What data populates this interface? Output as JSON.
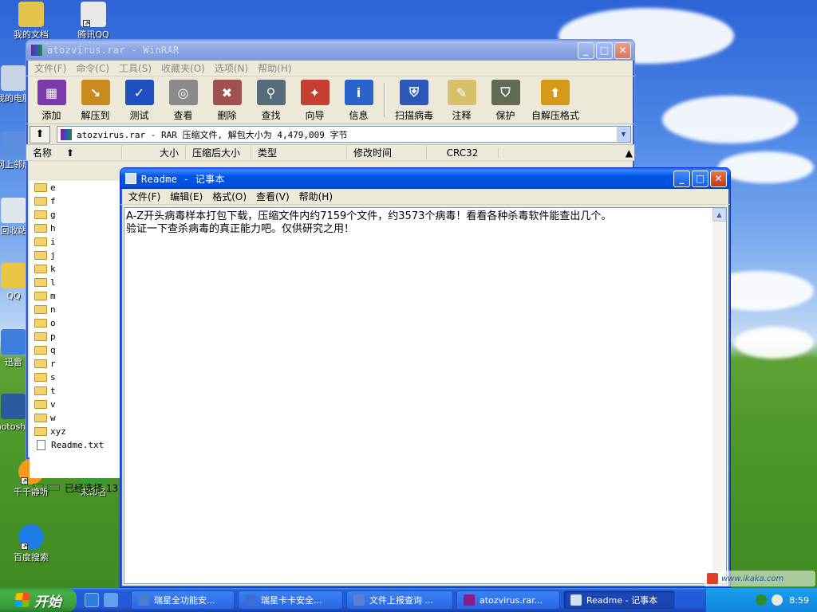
{
  "desktop": {
    "icons": [
      {
        "label": "我的文档",
        "color": "#e3c34a"
      },
      {
        "label": "腾讯QQ",
        "color": "#e8e8e8"
      },
      {
        "label": "我的电脑",
        "color": "#c8d3e6"
      },
      {
        "label": "网上邻居",
        "color": "#5b8ede"
      },
      {
        "label": "回收站",
        "color": "#dfe6ee"
      },
      {
        "label": "QQ",
        "color": "#e9c542"
      },
      {
        "label": "迅雷",
        "color": "#3d7fde"
      },
      {
        "label": "Photoshop",
        "color": "#2c5aa0"
      },
      {
        "label": "千千静听",
        "color": "#f39a1c"
      },
      {
        "label": "未命名",
        "color": "#3a9a3a"
      },
      {
        "label": "百度搜索",
        "color": "#1f7de6"
      }
    ]
  },
  "winrar": {
    "title": "atozvirus.rar - WinRAR",
    "menu": [
      "文件(F)",
      "命令(C)",
      "工具(S)",
      "收藏夹(O)",
      "选项(N)",
      "帮助(H)"
    ],
    "toolbar": [
      {
        "label": "添加",
        "icon": "add-archive-icon",
        "color": "#7a3aa8"
      },
      {
        "label": "解压到",
        "icon": "extract-to-icon",
        "color": "#c98a1e"
      },
      {
        "label": "测试",
        "icon": "test-icon",
        "color": "#1d4fbf"
      },
      {
        "label": "查看",
        "icon": "view-icon",
        "color": "#8a8a8a"
      },
      {
        "label": "删除",
        "icon": "delete-icon",
        "color": "#a05050"
      },
      {
        "label": "查找",
        "icon": "find-icon",
        "color": "#556b7a"
      },
      {
        "label": "向导",
        "icon": "wizard-icon",
        "color": "#c43f2f"
      },
      {
        "label": "信息",
        "icon": "info-icon",
        "color": "#2a63c9"
      },
      {
        "label": "扫描病毒",
        "icon": "scan-virus-icon",
        "color": "#2d57b8"
      },
      {
        "label": "注释",
        "icon": "comment-icon",
        "color": "#d8c06a"
      },
      {
        "label": "保护",
        "icon": "protect-icon",
        "color": "#5f6b55"
      },
      {
        "label": "自解压格式",
        "icon": "sfx-icon",
        "color": "#d59a1a"
      }
    ],
    "address": "atozvirus.rar - RAR 压缩文件, 解包大小为 4,479,009 字节",
    "columns": [
      "名称",
      "大小",
      "压缩后大小",
      "类型",
      "修改时间",
      "CRC32"
    ],
    "files": [
      "e",
      "f",
      "g",
      "h",
      "i",
      "j",
      "k",
      "l",
      "m",
      "n",
      "o",
      "p",
      "q",
      "r",
      "s",
      "t",
      "v",
      "w",
      "xyz"
    ],
    "txt_file": "Readme.txt",
    "status": "已经选择 13"
  },
  "notepad": {
    "title": "Readme - 记事本",
    "menu": [
      "文件(F)",
      "编辑(E)",
      "格式(O)",
      "查看(V)",
      "帮助(H)"
    ],
    "text": "A-Z开头病毒样本打包下载，压缩文件内约7159个文件，约3573个病毒！看看各种杀毒软件能查出几个。\n验证一下查杀病毒的真正能力吧。仅供研究之用！"
  },
  "taskbar": {
    "start_label": "开始",
    "tasks": [
      {
        "label": "瑞星全功能安...",
        "color": "#4a7fd0",
        "active": false
      },
      {
        "label": "瑞星卡卡安全...",
        "color": "#3c6fd0",
        "active": false
      },
      {
        "label": "文件上报查询 ...",
        "color": "#5a7fd0",
        "active": false
      },
      {
        "label": "atozvirus.rar...",
        "color": "#8b1a8b",
        "active": false
      },
      {
        "label": "Readme - 记事本",
        "color": "#cfe0f7",
        "active": true
      }
    ],
    "clock": "8:59",
    "watermark": "www.ikaka.com"
  }
}
